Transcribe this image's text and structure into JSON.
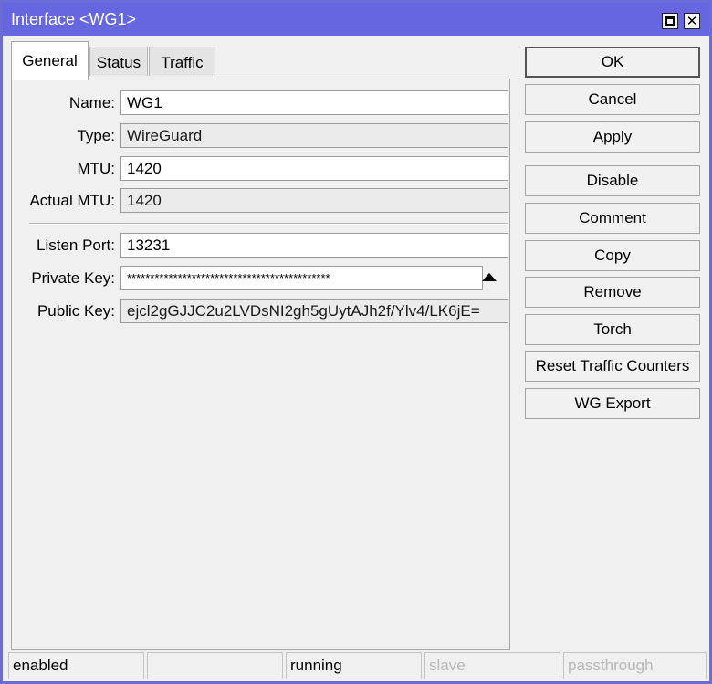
{
  "window": {
    "title": "Interface <WG1>"
  },
  "tabs": [
    {
      "label": "General",
      "active": true
    },
    {
      "label": "Status",
      "active": false
    },
    {
      "label": "Traffic",
      "active": false
    }
  ],
  "form": {
    "name_label": "Name:",
    "name_value": "WG1",
    "type_label": "Type:",
    "type_value": "WireGuard",
    "mtu_label": "MTU:",
    "mtu_value": "1420",
    "actual_mtu_label": "Actual MTU:",
    "actual_mtu_value": "1420",
    "listen_port_label": "Listen Port:",
    "listen_port_value": "13231",
    "private_key_label": "Private Key:",
    "private_key_value": "********************************************",
    "public_key_label": "Public Key:",
    "public_key_value": "ejcl2gGJJC2u2LVDsNI2gh5gUytAJh2f/Ylv4/LK6jE="
  },
  "buttons": {
    "ok": "OK",
    "cancel": "Cancel",
    "apply": "Apply",
    "disable": "Disable",
    "comment": "Comment",
    "copy": "Copy",
    "remove": "Remove",
    "torch": "Torch",
    "reset_traffic_counters": "Reset Traffic Counters",
    "wg_export": "WG Export"
  },
  "status": {
    "enabled": "enabled",
    "empty": "",
    "running": "running",
    "slave": "slave",
    "passthrough": "passthrough"
  },
  "icons": {
    "maximize": "maximize-icon",
    "close": "close-icon",
    "toggle": "triangle-up-icon"
  },
  "colors": {
    "titlebar": "#6666e0",
    "window_bg": "#f0f0f0"
  }
}
